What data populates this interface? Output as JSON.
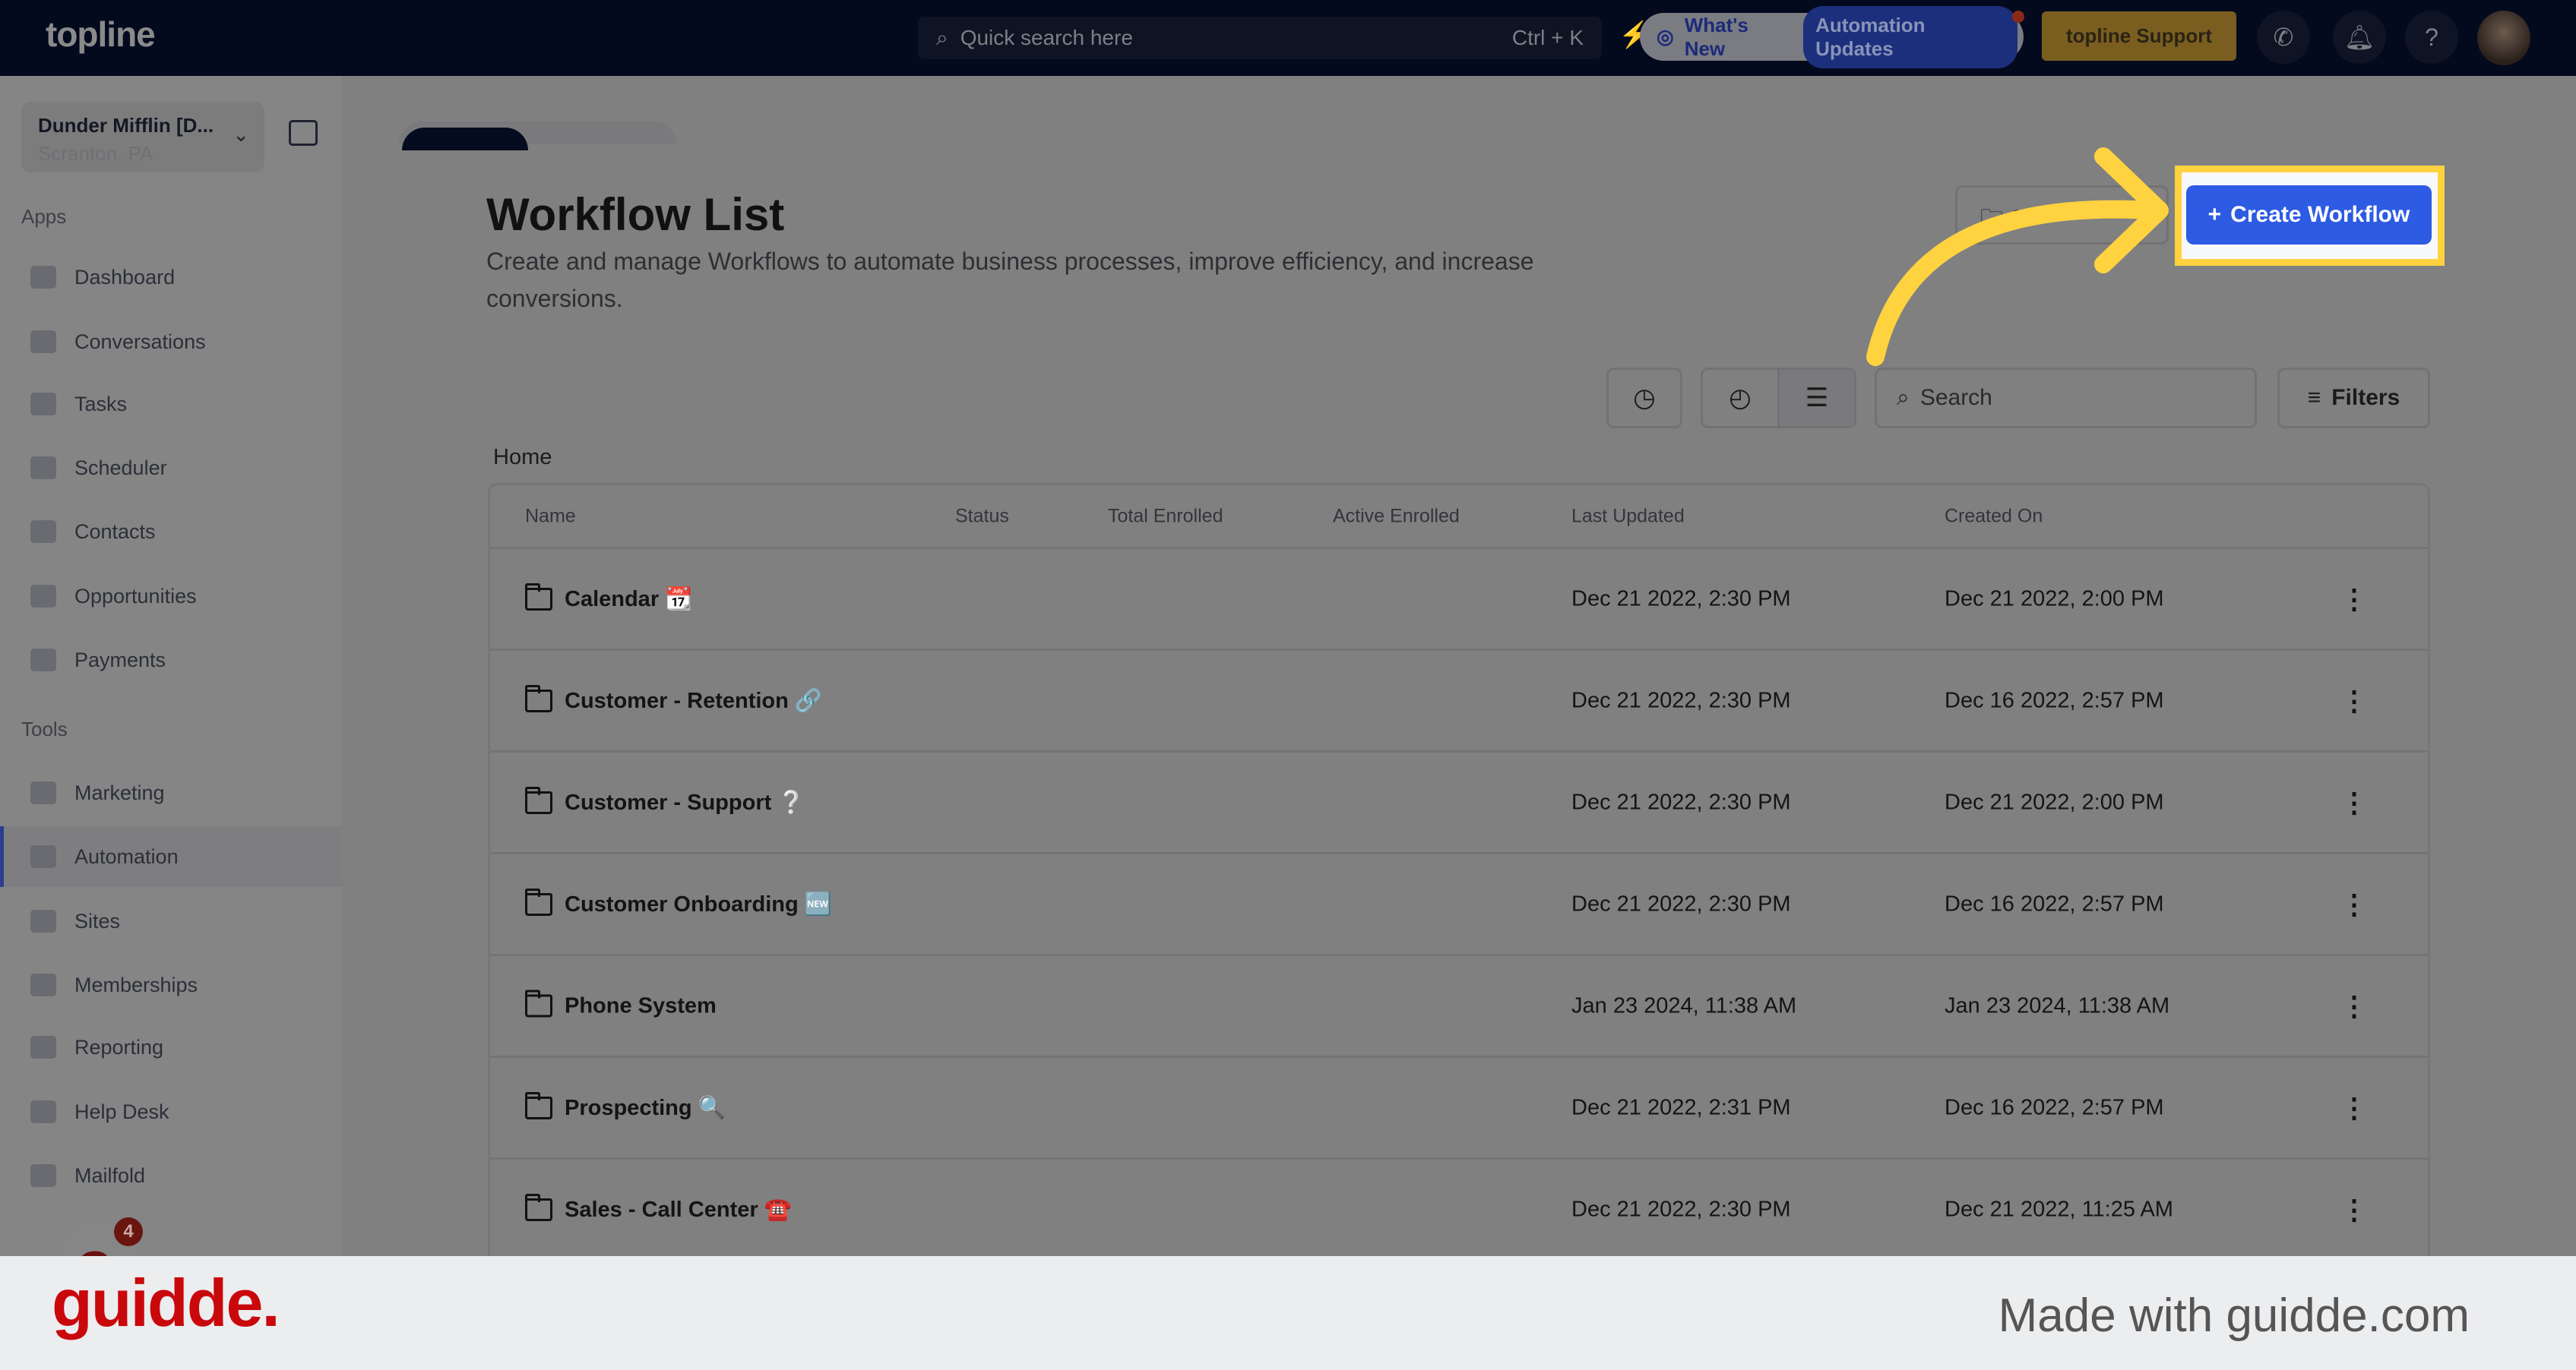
{
  "topbar": {
    "logo": "topline",
    "search_placeholder": "Quick search here",
    "search_shortcut": "Ctrl + K",
    "whats_new": "What's New",
    "automation_updates": "Automation Updates",
    "support": "topline Support"
  },
  "sidebar": {
    "account_name": "Dunder Mifflin [D...",
    "account_location": "Scranton, PA",
    "apps_label": "Apps",
    "apps": [
      {
        "label": "Dashboard"
      },
      {
        "label": "Conversations"
      },
      {
        "label": "Tasks"
      },
      {
        "label": "Scheduler"
      },
      {
        "label": "Contacts"
      },
      {
        "label": "Opportunities"
      },
      {
        "label": "Payments"
      }
    ],
    "tools_label": "Tools",
    "tools": [
      {
        "label": "Marketing"
      },
      {
        "label": "Automation",
        "active": true
      },
      {
        "label": "Sites"
      },
      {
        "label": "Memberships"
      },
      {
        "label": "Reporting"
      },
      {
        "label": "Help Desk"
      },
      {
        "label": "Mailfold"
      }
    ],
    "chat_badge": "4"
  },
  "main": {
    "title": "Workflow List",
    "subtitle": "Create and manage Workflows to automate business processes, improve efficiency, and increase conversions.",
    "create_button": "Create Workflow",
    "folder_button": "C",
    "search_placeholder": "Search",
    "filters_label": "Filters",
    "breadcrumb": "Home",
    "columns": [
      "Name",
      "Status",
      "Total Enrolled",
      "Active Enrolled",
      "Last Updated",
      "Created On"
    ],
    "rows": [
      {
        "name": "Calendar 📆",
        "last_updated": "Dec 21 2022, 2:30 PM",
        "created_on": "Dec 21 2022, 2:00 PM"
      },
      {
        "name": "Customer - Retention 🔗",
        "last_updated": "Dec 21 2022, 2:30 PM",
        "created_on": "Dec 16 2022, 2:57 PM"
      },
      {
        "name": "Customer - Support ❔",
        "last_updated": "Dec 21 2022, 2:30 PM",
        "created_on": "Dec 21 2022, 2:00 PM"
      },
      {
        "name": "Customer Onboarding 🆕",
        "last_updated": "Dec 21 2022, 2:30 PM",
        "created_on": "Dec 16 2022, 2:57 PM"
      },
      {
        "name": "Phone System",
        "last_updated": "Jan 23 2024, 11:38 AM",
        "created_on": "Jan 23 2024, 11:38 AM"
      },
      {
        "name": "Prospecting 🔍",
        "last_updated": "Dec 21 2022, 2:31 PM",
        "created_on": "Dec 16 2022, 2:57 PM"
      },
      {
        "name": "Sales - Call Center ☎️",
        "last_updated": "Dec 21 2022, 2:30 PM",
        "created_on": "Dec 21 2022, 11:25 AM"
      }
    ]
  },
  "footer": {
    "brand": "guidde.",
    "made_with": "Made with guidde.com"
  },
  "colors": {
    "accent": "#2d5be3",
    "highlight": "#ffd240",
    "brand": "#c9080c"
  }
}
